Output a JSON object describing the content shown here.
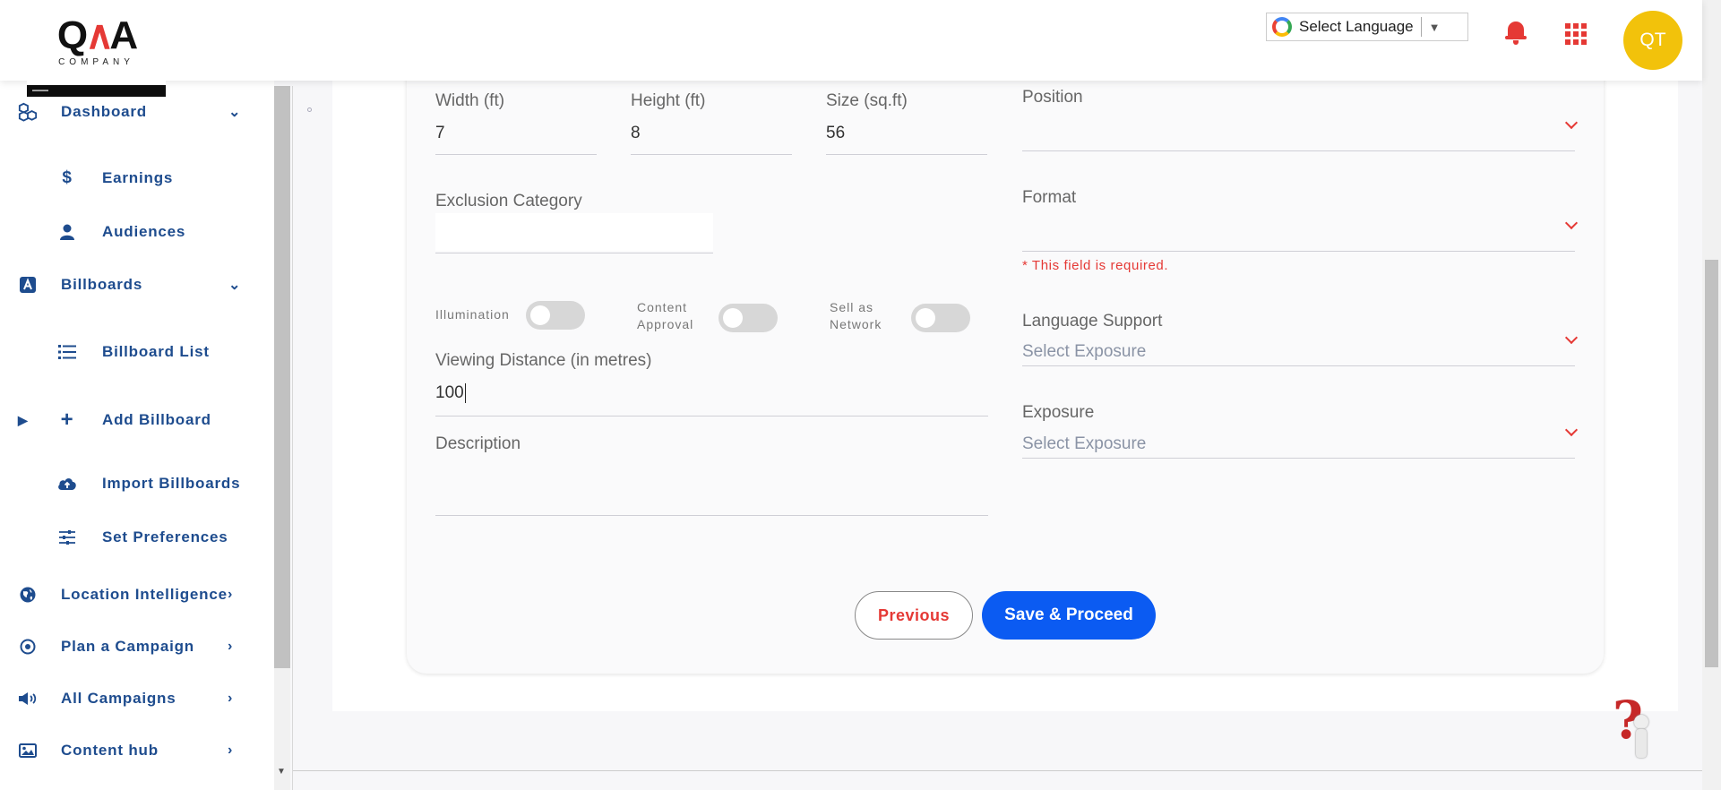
{
  "header": {
    "logo_text": "QA",
    "logo_sub": "COMPANY",
    "language_label": "Select Language",
    "language_arrow": "▼",
    "avatar_initials": "QT"
  },
  "sidebar": {
    "items": [
      {
        "label": "Dashboard",
        "icon": "dashboard-icon"
      },
      {
        "label": "Earnings",
        "icon": "dollar-icon"
      },
      {
        "label": "Audiences",
        "icon": "user-icon"
      },
      {
        "label": "Billboards",
        "icon": "billboard-icon"
      },
      {
        "label": "Billboard List",
        "icon": "list-icon"
      },
      {
        "label": "Add Billboard",
        "icon": "plus-icon"
      },
      {
        "label": "Import Billboards",
        "icon": "cloud-upload-icon"
      },
      {
        "label": "Set Preferences",
        "icon": "sliders-icon"
      },
      {
        "label": "Location Intelligence",
        "icon": "globe-icon"
      },
      {
        "label": "Plan a Campaign",
        "icon": "target-icon"
      },
      {
        "label": "All Campaigns",
        "icon": "megaphone-icon"
      },
      {
        "label": "Content hub",
        "icon": "image-icon"
      }
    ]
  },
  "form": {
    "width": {
      "label": "Width (ft)",
      "value": "7"
    },
    "height": {
      "label": "Height (ft)",
      "value": "8"
    },
    "size": {
      "label": "Size (sq.ft)",
      "value": "56"
    },
    "position": {
      "label": "Position"
    },
    "exclusion_category": {
      "label": "Exclusion Category"
    },
    "format": {
      "label": "Format",
      "error": "* This field is required."
    },
    "toggles": {
      "illumination": "Illumination",
      "content_approval": "Content Approval",
      "sell_as_network": "Sell as Network"
    },
    "language_support": {
      "label": "Language Support",
      "placeholder": "Select Exposure"
    },
    "viewing_distance": {
      "label": "Viewing Distance (in metres)",
      "value": "100"
    },
    "exposure": {
      "label": "Exposure",
      "placeholder": "Select Exposure"
    },
    "description": {
      "label": "Description"
    }
  },
  "buttons": {
    "previous": "Previous",
    "save": "Save & Proceed"
  },
  "help": {
    "symbol": "?"
  },
  "colors": {
    "accent_red": "#e53935",
    "primary_blue": "#0b5bf2",
    "nav_blue": "#1e4c8e",
    "avatar_yellow": "#f2c20b"
  }
}
